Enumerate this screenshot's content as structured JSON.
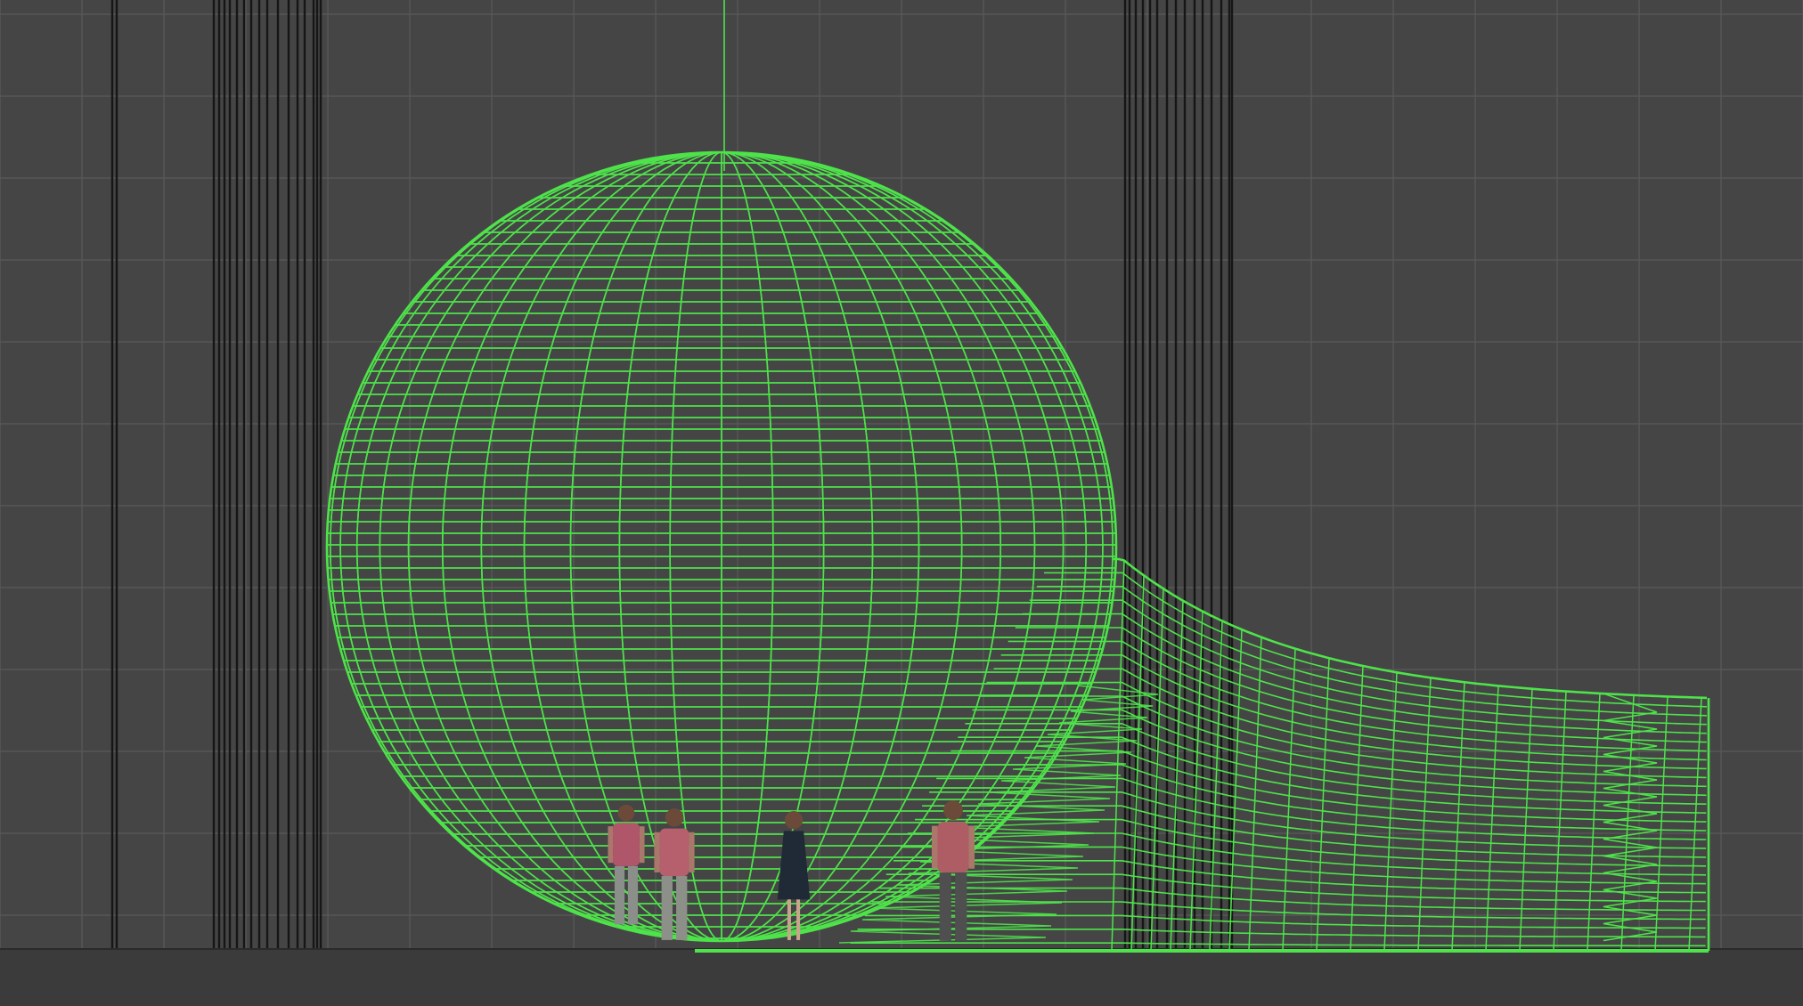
{
  "viewport": {
    "view": "wireframe-elevation",
    "background_color": "#454545",
    "grid_color": "#5a5a5a",
    "wire_color": "#4ee34a",
    "column_line_color": "#111111",
    "ground_color": "#3b3b3b"
  },
  "scene_objects": [
    {
      "name": "sphere-wireframe",
      "type": "sphere"
    },
    {
      "name": "tail-tube-wireframe",
      "type": "extruded tube"
    },
    {
      "name": "person-figures",
      "type": "scale figures",
      "count": 4
    }
  ]
}
